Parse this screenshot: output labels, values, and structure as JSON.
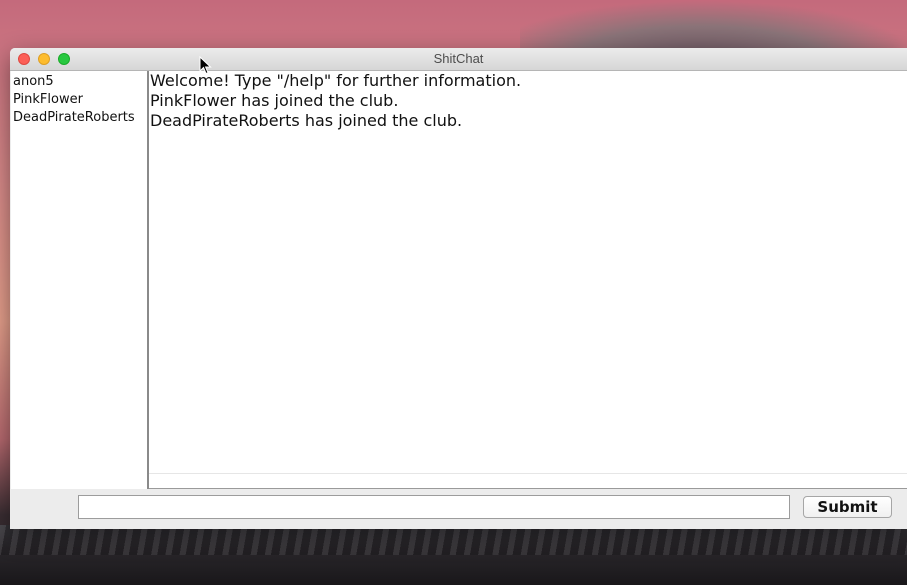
{
  "window": {
    "title": "ShitChat"
  },
  "users": [
    "anon5",
    "PinkFlower",
    "DeadPirateRoberts"
  ],
  "messages": [
    "Welcome! Type \"/help\" for further information.",
    "PinkFlower has joined the club.",
    "DeadPirateRoberts has joined the club."
  ],
  "input": {
    "value": "",
    "placeholder": ""
  },
  "submit_label": "Submit",
  "colors": {
    "close": "#fc5f57",
    "minimize": "#fdbc2e",
    "zoom": "#28c840"
  },
  "icons": [
    "close-icon",
    "minimize-icon",
    "zoom-icon",
    "mouse-pointer-icon"
  ]
}
